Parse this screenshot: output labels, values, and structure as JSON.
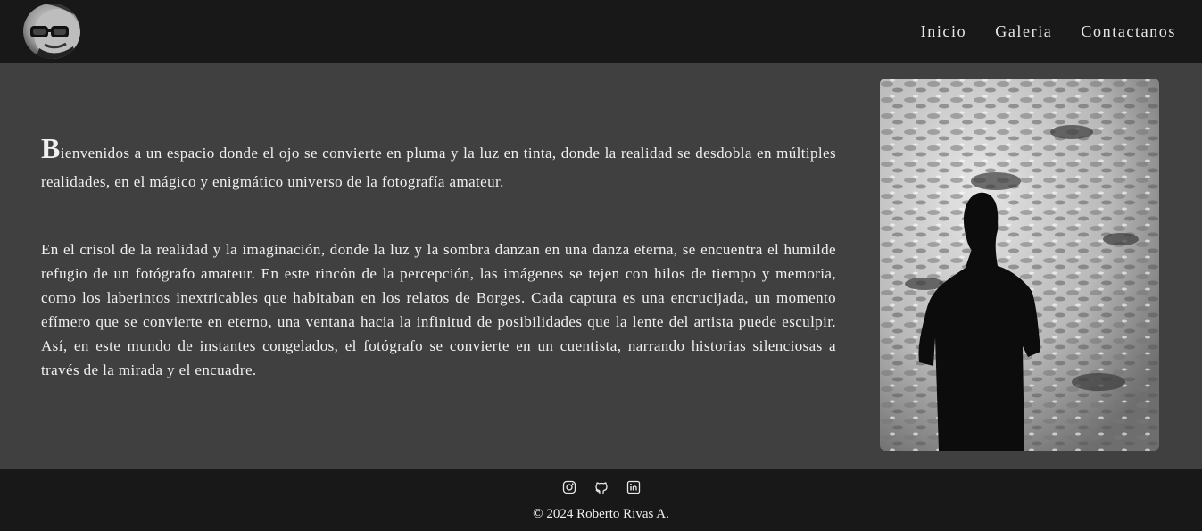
{
  "header": {
    "nav": [
      {
        "label": "Inicio"
      },
      {
        "label": "Galeria"
      },
      {
        "label": "Contactanos"
      }
    ]
  },
  "main": {
    "intro": {
      "dropcap": "B",
      "text": "ienvenidos a un espacio donde el ojo se convierte en pluma y la luz en tinta, donde la realidad se desdobla en múltiples realidades, en el mágico y enigmático universo de la fotografía amateur."
    },
    "body": "En el crisol de la realidad y la imaginación, donde la luz y la sombra danzan en una danza eterna, se encuentra el humilde refugio de un fotógrafo amateur. En este rincón de la percepción, las imágenes se tejen con hilos de tiempo y memoria, como los laberintos inextricables que habitaban en los relatos de Borges. Cada captura es una encrucijada, un momento efímero que se convierte en eterno, una ventana hacia la infinitud de posibilidades que la lente del artista puede esculpir. Así, en este mundo de instantes congelados, el fotógrafo se convierte en un cuentista, narrando historias silenciosas a través de la mirada y el encuadre."
  },
  "footer": {
    "socials": [
      {
        "icon": "instagram-icon"
      },
      {
        "icon": "github-icon"
      },
      {
        "icon": "linkedin-icon"
      }
    ],
    "copyright": "© 2024 Roberto Rivas A."
  },
  "colors": {
    "header_bg": "#181818",
    "main_bg": "#404040",
    "text": "#f0f0f0"
  }
}
